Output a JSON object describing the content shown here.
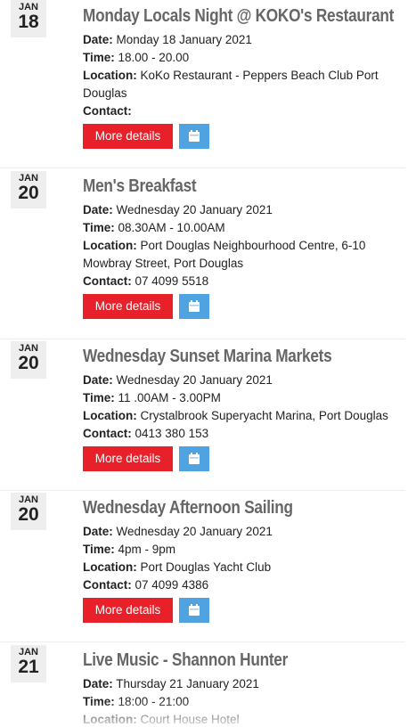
{
  "labels": {
    "date": "Date:",
    "time": "Time:",
    "location": "Location:",
    "contact": "Contact:",
    "more_details": "More details"
  },
  "events": [
    {
      "month": "JAN",
      "day": "18",
      "title": "Monday Locals Night @ KOKO's Restaurant",
      "date": "Monday 18 January 2021",
      "time": "18.00 - 20.00",
      "location": "KoKo Restaurant - Peppers Beach Club Port Douglas",
      "contact": ""
    },
    {
      "month": "JAN",
      "day": "20",
      "title": "Men's Breakfast",
      "date": "Wednesday 20 January 2021",
      "time": "08.30AM - 10.00AM",
      "location": "Port Douglas Neighbourhood Centre, 6-10 Mowbray Street, Port Douglas",
      "contact": "07 4099 5518"
    },
    {
      "month": "JAN",
      "day": "20",
      "title": "Wednesday Sunset Marina Markets",
      "date": "Wednesday 20 January 2021",
      "time": "11 .00AM - 3.00PM",
      "location": "Crystalbrook Superyacht Marina, Port Douglas",
      "contact": "0413 380 153"
    },
    {
      "month": "JAN",
      "day": "20",
      "title": "Wednesday Afternoon Sailing",
      "date": "Wednesday 20 January 2021",
      "time": "4pm - 9pm",
      "location": "Port Douglas Yacht Club",
      "contact": "07 4099 4386"
    },
    {
      "month": "JAN",
      "day": "21",
      "title": "Live Music - Shannon Hunter",
      "date": "Thursday 21 January 2021",
      "time": "18:00 - 21:00",
      "location": "Court House Hotel"
    }
  ],
  "colors": {
    "more_button": "#e8202a",
    "calendar_button": "#4fa3e0",
    "title_text": "#666666",
    "date_box": "#eeeeee"
  },
  "icons": {
    "calendar_button": "calendar-icon"
  }
}
